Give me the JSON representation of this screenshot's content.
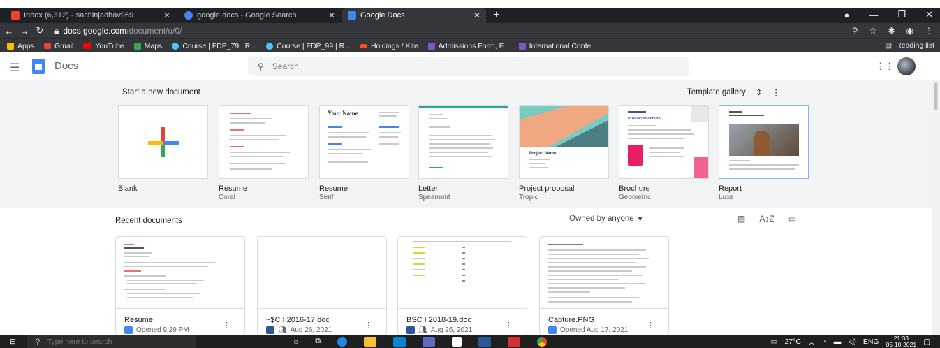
{
  "browser": {
    "tabs": [
      {
        "label": "Inbox (6,312) - sachinjadhav969",
        "fav_color": "#ea4335"
      },
      {
        "label": "google docs - Google Search",
        "fav_color": "#4285f4"
      },
      {
        "label": "Google Docs",
        "fav_color": "#4285f4"
      }
    ],
    "url_domain": "docs.google.com",
    "url_path": "/document/u/0/",
    "bookmarks": [
      {
        "label": "Apps",
        "color": "#fbbc04"
      },
      {
        "label": "Gmail",
        "color": "#ea4335"
      },
      {
        "label": "YouTube",
        "color": "#ff0000"
      },
      {
        "label": "Maps",
        "color": "#34a853"
      },
      {
        "label": "Course | FDP_79 | R...",
        "color": "#4fc3f7"
      },
      {
        "label": "Course | FDP_99 | R...",
        "color": "#4fc3f7"
      },
      {
        "label": "Holdings / Kite",
        "color": "#f4511e"
      },
      {
        "label": "Admissions Form, F...",
        "color": "#7e57c2"
      },
      {
        "label": "International Confe...",
        "color": "#7e57c2"
      }
    ],
    "reading_list": "Reading list"
  },
  "header": {
    "title": "Docs",
    "search_placeholder": "Search"
  },
  "new_document": {
    "title": "Start a new document",
    "template_gallery": "Template gallery",
    "templates": [
      {
        "name": "Blank",
        "sub": ""
      },
      {
        "name": "Resume",
        "sub": "Coral"
      },
      {
        "name": "Resume",
        "sub": "Serif"
      },
      {
        "name": "Letter",
        "sub": "Spearmint"
      },
      {
        "name": "Project proposal",
        "sub": "Tropic"
      },
      {
        "name": "Brochure",
        "sub": "Geometric"
      },
      {
        "name": "Report",
        "sub": "Luxe"
      }
    ]
  },
  "recent": {
    "title": "Recent documents",
    "owner_filter": "Owned by anyone",
    "documents": [
      {
        "name": "Resume",
        "meta": "Opened 9:29 PM",
        "type_color": "#4285f4",
        "type_glyph": "≡"
      },
      {
        "name": "~$C I 2016-17.doc",
        "meta": "Aug 26, 2021",
        "type_color": "#2b579a",
        "type_glyph": "W"
      },
      {
        "name": "BSC I 2018-19.doc",
        "meta": "Aug 26, 2021",
        "type_color": "#2b579a",
        "type_glyph": "W"
      },
      {
        "name": "Capture.PNG",
        "meta": "Opened Aug 17, 2021",
        "type_color": "#4285f4",
        "type_glyph": "≡"
      }
    ]
  },
  "taskbar": {
    "search_placeholder": "Type here to search",
    "temperature": "27°C",
    "language": "ENG",
    "time": "21:33",
    "date": "05-10-2021"
  }
}
